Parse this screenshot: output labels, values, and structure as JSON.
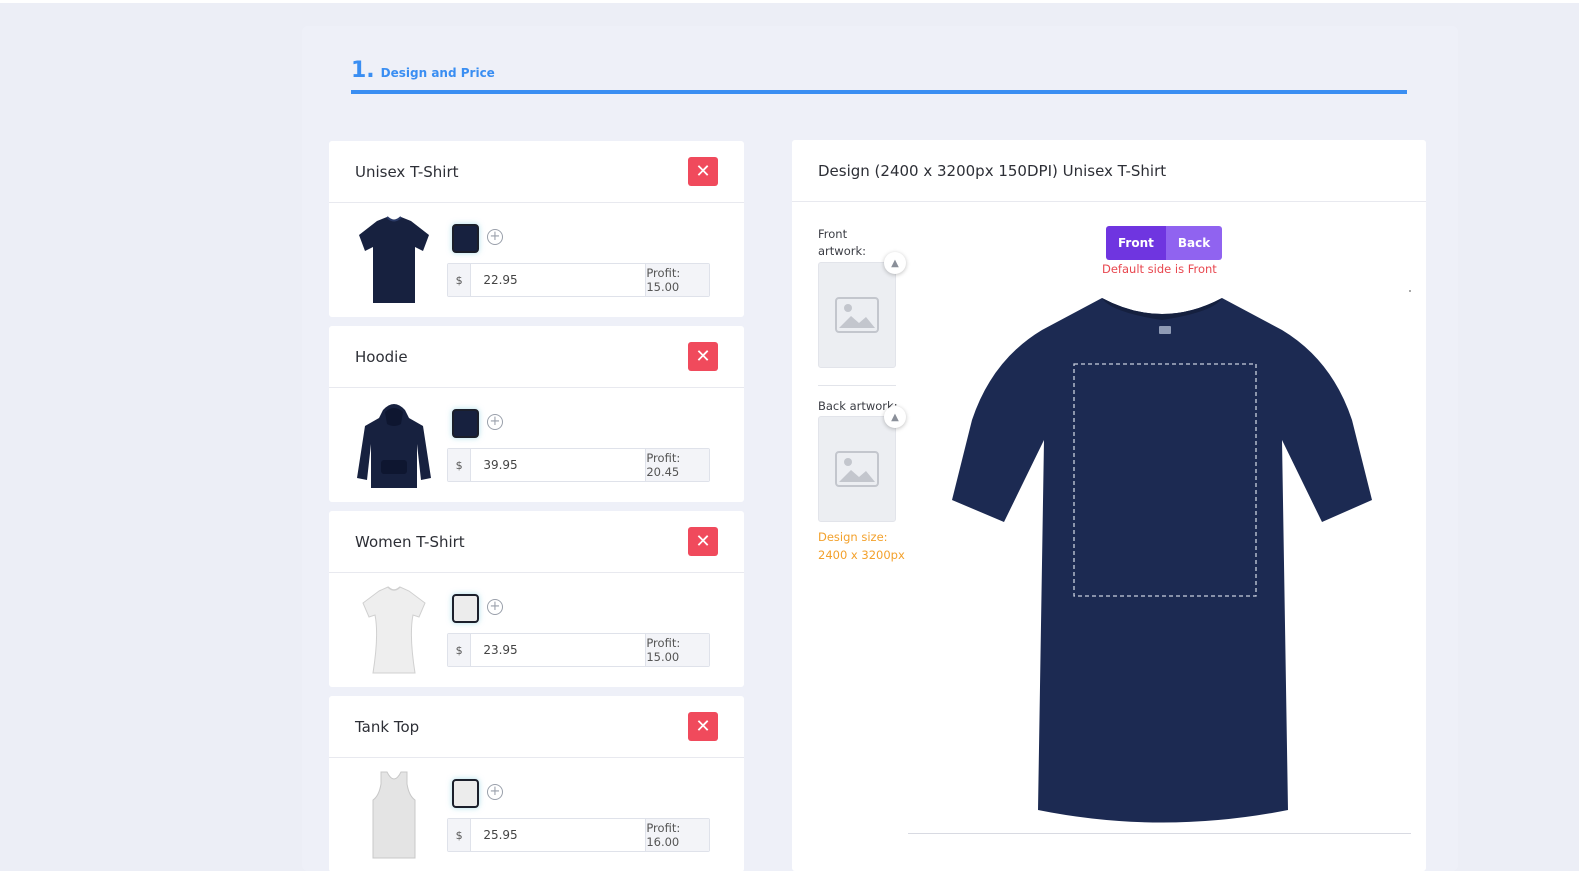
{
  "step": {
    "number": "1.",
    "title": "Design and Price"
  },
  "products": [
    {
      "name": "Unisex T-Shirt",
      "color_hex": "#17213f",
      "currency": "$",
      "price": "22.95",
      "profit": "Profit: 15.00",
      "thumb": "tshirt-navy"
    },
    {
      "name": "Hoodie",
      "color_hex": "#17213f",
      "currency": "$",
      "price": "39.95",
      "profit": "Profit: 20.45",
      "thumb": "hoodie-navy"
    },
    {
      "name": "Women T-Shirt",
      "color_hex": "#ececec",
      "currency": "$",
      "price": "23.95",
      "profit": "Profit: 15.00",
      "thumb": "women-tshirt-white"
    },
    {
      "name": "Tank Top",
      "color_hex": "#ececec",
      "currency": "$",
      "price": "25.95",
      "profit": "Profit: 16.00",
      "thumb": "tanktop-white"
    }
  ],
  "remove_label": "✕",
  "add_color_label": "+",
  "design": {
    "title": "Design (2400 x 3200px 150DPI) Unisex T-Shirt",
    "front_artwork_label": "Front artwork:",
    "back_artwork_label": "Back artwork:",
    "design_size_label": "Design size: 2400 x 3200px",
    "sides": [
      "Front",
      "Back"
    ],
    "active_side": "Front",
    "default_side_prefix": "Default side is ",
    "default_side_value": "Front",
    "mockup_color": "#1c2a52"
  },
  "colors": {
    "accent_blue": "#3a8ef2",
    "remove_red": "#f04a5c",
    "toggle_active": "#6f35e0",
    "toggle_inactive": "#9063f0",
    "design_size_orange": "#f3a12c"
  }
}
